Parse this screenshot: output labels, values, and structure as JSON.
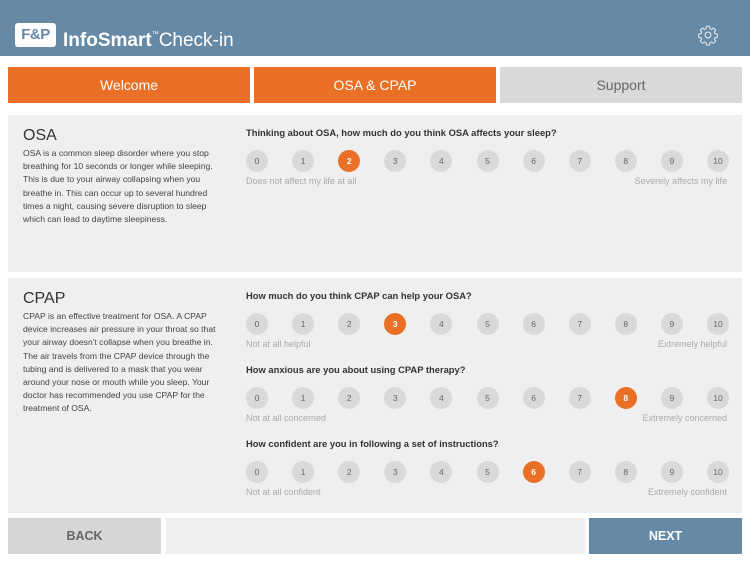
{
  "header": {
    "logo_text": "F&P",
    "brand_bold": "InfoSmart",
    "brand_tm": "™",
    "brand_light": "Check-in",
    "settings_icon": "gear-icon"
  },
  "tabs": [
    {
      "label": "Welcome",
      "state": "completed"
    },
    {
      "label": "OSA & CPAP",
      "state": "active"
    },
    {
      "label": "Support",
      "state": "inactive"
    }
  ],
  "osa": {
    "title": "OSA",
    "body": "OSA is a common sleep disorder where you stop breathing for 10 seconds or longer while sleeping. This is due to your airway collapsing when you breathe in. This can occur up to several hundred times a night, causing severe disruption to sleep which can lead to daytime sleepiness.",
    "questions": [
      {
        "text": "Thinking about OSA, how much do you think OSA affects your sleep?",
        "options": [
          "0",
          "1",
          "2",
          "3",
          "4",
          "5",
          "6",
          "7",
          "8",
          "9",
          "10"
        ],
        "selected": 2,
        "low_label": "Does not affect my life at all",
        "high_label": "Severely affects my life"
      }
    ]
  },
  "cpap": {
    "title": "CPAP",
    "body": "CPAP is an effective treatment for OSA. A CPAP device increases air pressure in your throat so that your airway doesn't collapse when you breathe in. The air travels from the CPAP device through the tubing and is delivered to a mask that you wear around your nose or mouth while you sleep. Your doctor has recommended you use CPAP for the treatment of OSA.",
    "questions": [
      {
        "text": "How much do you think CPAP can help your OSA?",
        "options": [
          "0",
          "1",
          "2",
          "3",
          "4",
          "5",
          "6",
          "7",
          "8",
          "9",
          "10"
        ],
        "selected": 3,
        "low_label": "Not at all helpful",
        "high_label": "Extremely helpful"
      },
      {
        "text": "How anxious are you about using CPAP therapy?",
        "options": [
          "0",
          "1",
          "2",
          "3",
          "4",
          "5",
          "6",
          "7",
          "8",
          "9",
          "10"
        ],
        "selected": 8,
        "low_label": "Not at all concerned",
        "high_label": "Extremely concerned"
      },
      {
        "text": "How confident are you in following a set of instructions?",
        "options": [
          "0",
          "1",
          "2",
          "3",
          "4",
          "5",
          "6",
          "7",
          "8",
          "9",
          "10"
        ],
        "selected": 6,
        "low_label": "Not at all confident",
        "high_label": "Extremely confident"
      }
    ]
  },
  "footer": {
    "back_label": "BACK",
    "next_label": "NEXT"
  },
  "colors": {
    "header_bg": "#6689a6",
    "accent_orange": "#ea7027",
    "inactive_gray": "#d9d9d9",
    "panel_bg": "#efefef"
  }
}
